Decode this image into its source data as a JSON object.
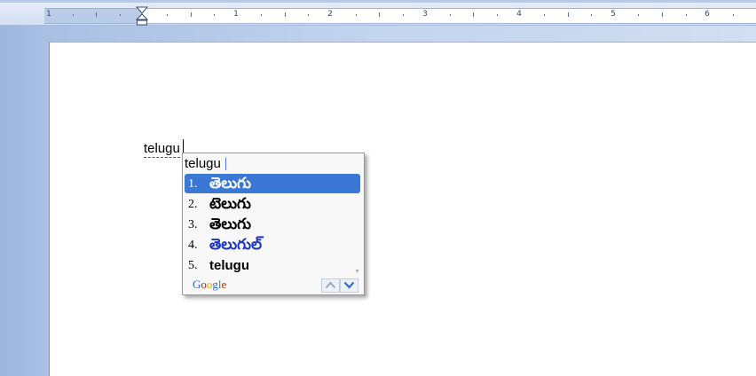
{
  "ruler": {
    "numbers": [
      "1",
      "1",
      "2",
      "3",
      "4",
      "5",
      "6"
    ]
  },
  "document": {
    "typed_text": "telugu"
  },
  "ime_popup": {
    "input_text": "telugu",
    "candidates": [
      {
        "num": "1.",
        "word": "తెలుగు"
      },
      {
        "num": "2.",
        "word": "టెలుగు"
      },
      {
        "num": "3.",
        "word": "తెలుగు"
      },
      {
        "num": "4.",
        "word": "తెలుగుల్"
      },
      {
        "num": "5.",
        "word": "telugu"
      }
    ],
    "selected_index": 0,
    "brand": {
      "letters": [
        "G",
        "o",
        "o",
        "g",
        "l",
        "e"
      ],
      "colors": [
        "#3366cc",
        "#cc2200",
        "#e8a500",
        "#3366cc",
        "#2a9a2a",
        "#cc2200"
      ]
    },
    "colors": {
      "selection": "#3b78d6",
      "blue_candidate": "#1a34c4"
    }
  }
}
